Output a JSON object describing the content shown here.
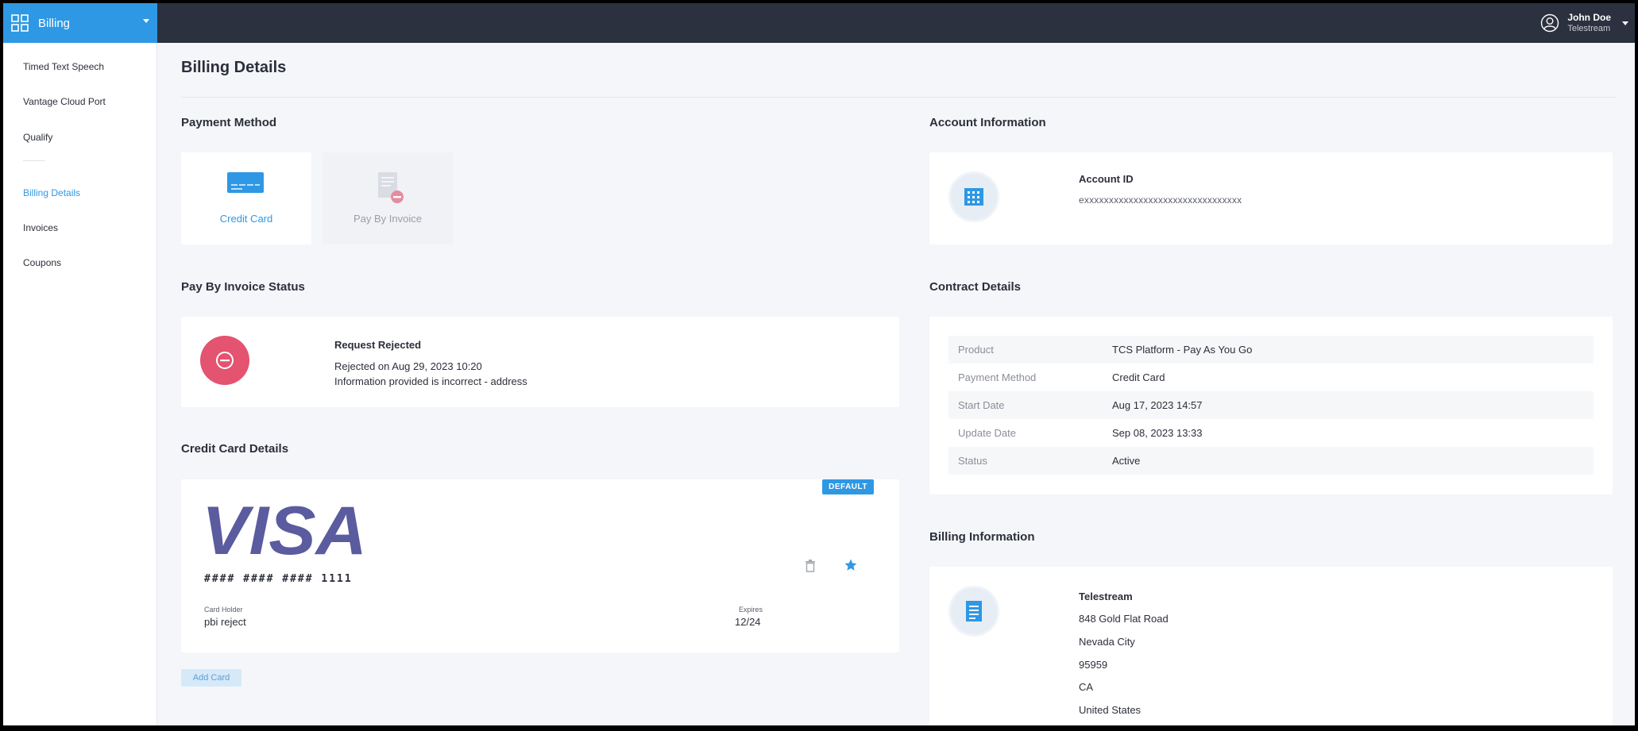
{
  "topbar": {
    "app_name": "Billing",
    "user": {
      "name": "John Doe",
      "org": "Telestream"
    }
  },
  "sidebar": {
    "items": [
      {
        "label": "Timed Text Speech"
      },
      {
        "label": "Vantage Cloud Port"
      },
      {
        "label": "Qualify"
      },
      {
        "label": "Billing Details",
        "active": true
      },
      {
        "label": "Invoices"
      },
      {
        "label": "Coupons"
      }
    ]
  },
  "page": {
    "title": "Billing Details"
  },
  "payment_method": {
    "title": "Payment Method",
    "options": [
      {
        "label": "Credit Card",
        "selected": true
      },
      {
        "label": "Pay By Invoice",
        "selected": false
      }
    ]
  },
  "pbi_status": {
    "title": "Pay By Invoice Status",
    "heading": "Request Rejected",
    "date_line": "Rejected on Aug 29, 2023 10:20",
    "reason_line": "Information provided is incorrect - address"
  },
  "credit_card": {
    "title": "Credit Card Details",
    "badge": "DEFAULT",
    "number": "#### #### #### 1111",
    "holder_label": "Card Holder",
    "holder": "pbi reject",
    "expires_label": "Expires",
    "expires": "12/24",
    "add_card_label": "Add Card"
  },
  "account": {
    "title": "Account Information",
    "id_label": "Account ID",
    "id_value": "exxxxxxxxxxxxxxxxxxxxxxxxxxxxxxxx"
  },
  "contract": {
    "title": "Contract Details",
    "rows": [
      {
        "key": "Product",
        "value": "TCS Platform - Pay As You Go"
      },
      {
        "key": "Payment Method",
        "value": "Credit Card"
      },
      {
        "key": "Start Date",
        "value": "Aug 17, 2023 14:57"
      },
      {
        "key": "Update Date",
        "value": "Sep 08, 2023 13:33"
      },
      {
        "key": "Status",
        "value": "Active"
      }
    ]
  },
  "billing_info": {
    "title": "Billing Information",
    "company": "Telestream",
    "address": "848 Gold Flat Road",
    "city": "Nevada City",
    "zip": "95959",
    "state": "CA",
    "country": "United States"
  },
  "colors": {
    "accent": "#2e98e4",
    "topbar": "#2c313f",
    "rejected": "#e4536f",
    "visa": "#5b5b9f"
  }
}
